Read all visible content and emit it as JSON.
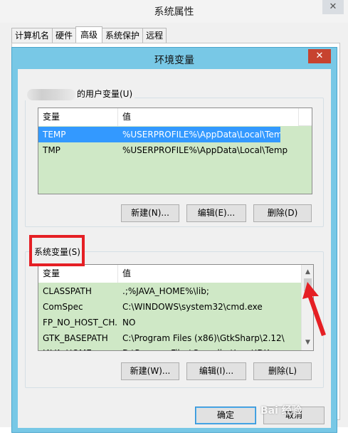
{
  "background_window": {
    "title": "系统属性",
    "close": "✕",
    "tabs": [
      {
        "label": "计算机名",
        "active": false
      },
      {
        "label": "硬件",
        "active": false
      },
      {
        "label": "高级",
        "active": true
      },
      {
        "label": "系统保护",
        "active": false
      },
      {
        "label": "远程",
        "active": false
      }
    ]
  },
  "dialog": {
    "title": "环境变量",
    "close": "✕",
    "user_section": {
      "label_suffix": "的用户变量(U)",
      "columns": [
        "变量",
        "值"
      ],
      "rows": [
        {
          "name": "TEMP",
          "value": "%USERPROFILE%\\AppData\\Local\\Temp",
          "selected": true
        },
        {
          "name": "TMP",
          "value": "%USERPROFILE%\\AppData\\Local\\Temp",
          "selected": false
        }
      ],
      "buttons": {
        "new": "新建(N)...",
        "edit": "编辑(E)...",
        "delete": "删除(D)"
      }
    },
    "system_section": {
      "label": "系统变量(S)",
      "columns": [
        "变量",
        "值"
      ],
      "rows": [
        {
          "name": "CLASSPATH",
          "value": ".;%JAVA_HOME%\\lib;"
        },
        {
          "name": "ComSpec",
          "value": "C:\\WINDOWS\\system32\\cmd.exe"
        },
        {
          "name": "FP_NO_HOST_CH...",
          "value": "NO"
        },
        {
          "name": "GTK_BASEPATH",
          "value": "C:\\Program Files (x86)\\GtkSharp\\2.12\\"
        },
        {
          "name": "JAVA_HOME",
          "value": "D:\\ProgramFiles\\Complier\\Java\\JDK"
        }
      ],
      "buttons": {
        "new": "新建(W)...",
        "edit": "编辑(I)...",
        "delete": "删除(L)"
      }
    },
    "ok": "确定",
    "cancel": "取消"
  },
  "annotations": {
    "highlight_color": "#e51f24",
    "watermark": "Bai 经验"
  },
  "colors": {
    "dialog_frame": "#78c8e6",
    "list_background": "#cfe8c6",
    "selection": "#3399ff",
    "close_button": "#c7432f"
  },
  "icons": {
    "scroll_up": "chevron-up-icon",
    "scroll_down": "chevron-down-icon",
    "arrow": "red-arrow-icon"
  }
}
